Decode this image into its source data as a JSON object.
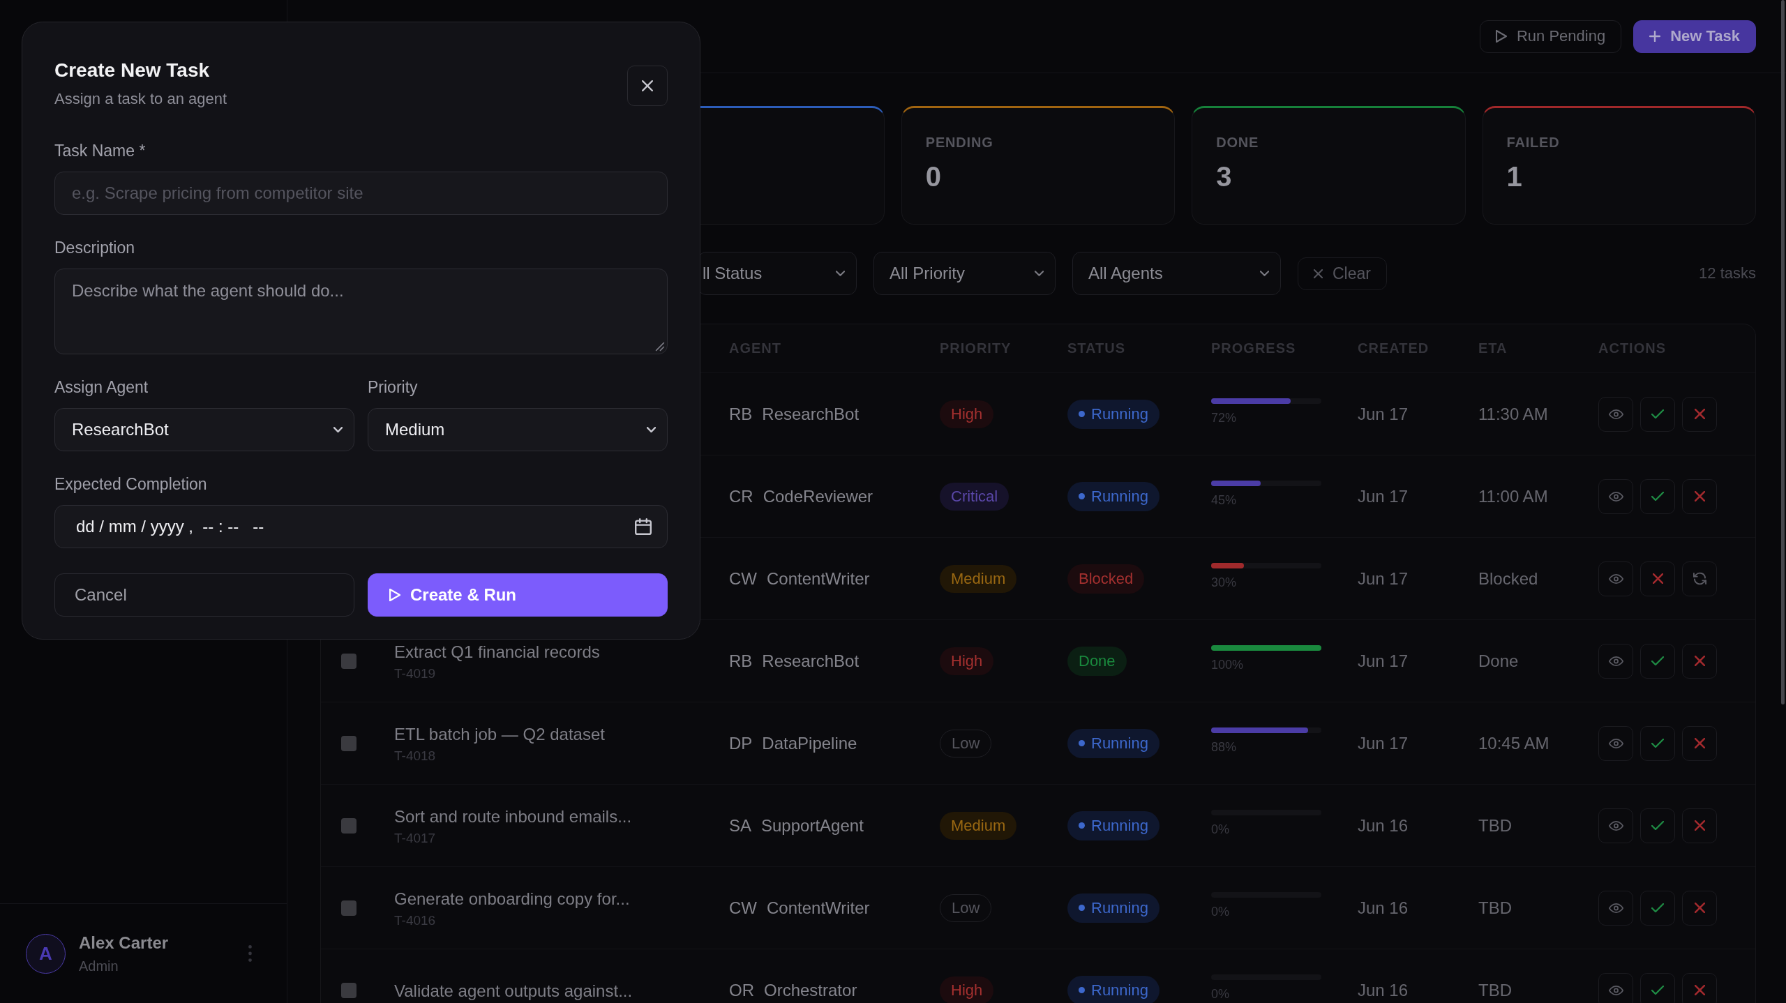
{
  "sidebar": {
    "user": {
      "initial": "A",
      "name": "Alex Carter",
      "role": "Admin"
    }
  },
  "header": {
    "run_pending_button": "Run Pending",
    "new_task_button": "New Task"
  },
  "stats": [
    {
      "color": "#2c5cb8"
    },
    {
      "label": "PENDING",
      "value": "0",
      "color": "#a06410"
    },
    {
      "label": "DONE",
      "value": "3",
      "color": "#16803a"
    },
    {
      "label": "FAILED",
      "value": "1",
      "color": "#a0282a"
    }
  ],
  "filters": {
    "selects": [
      "ll Status",
      "All Priority",
      "All Agents"
    ],
    "clear_button": "Clear",
    "count": "12 tasks"
  },
  "table": {
    "columns": [
      "AGENT",
      "PRIORITY",
      "STATUS",
      "PROGRESS",
      "CREATED",
      "ETA",
      "ACTIONS"
    ],
    "rows": [
      {
        "agent_initials": "RB",
        "agent": "ResearchBot",
        "priority": {
          "label": "High",
          "kind": "high"
        },
        "status": {
          "label": "Running",
          "kind": "running"
        },
        "progress": {
          "level": 0.72,
          "label": "72%"
        },
        "created": "Jun 17",
        "eta": "11:30 AM",
        "actions": [
          {
            "kind": "view"
          },
          {
            "kind": "approve"
          },
          {
            "kind": "cancel"
          }
        ]
      },
      {
        "agent_initials": "CR",
        "agent": "CodeReviewer",
        "priority": {
          "label": "Critical",
          "kind": "critical"
        },
        "status": {
          "label": "Running",
          "kind": "running"
        },
        "progress": {
          "level": 0.45,
          "label": "45%"
        },
        "created": "Jun 17",
        "eta": "11:00 AM",
        "actions": [
          {
            "kind": "view"
          },
          {
            "kind": "approve"
          },
          {
            "kind": "cancel"
          }
        ]
      },
      {
        "agent_initials": "CW",
        "agent": "ContentWriter",
        "priority": {
          "label": "Medium",
          "kind": "medium"
        },
        "status": {
          "label": "Blocked",
          "kind": "blocked"
        },
        "progress": {
          "level": 0.3,
          "label": "30%"
        },
        "created": "Jun 17",
        "eta": "Blocked",
        "actions": [
          {
            "kind": "view"
          },
          {
            "kind": "cancel"
          },
          {
            "kind": "retry"
          }
        ]
      },
      {
        "checked": false,
        "name": "Extract Q1 financial records",
        "id": "T-4019",
        "agent_initials": "RB",
        "agent": "ResearchBot",
        "priority": {
          "label": "High",
          "kind": "high"
        },
        "status": {
          "label": "Done",
          "kind": "done"
        },
        "progress": {
          "level": 1,
          "label": "100%"
        },
        "created": "Jun 17",
        "eta": "Done",
        "actions": [
          {
            "kind": "view"
          },
          {
            "kind": "approve"
          },
          {
            "kind": "cancel"
          }
        ]
      },
      {
        "checked": false,
        "name": "ETL batch job — Q2 dataset",
        "id": "T-4018",
        "agent_initials": "DP",
        "agent": "DataPipeline",
        "priority": {
          "label": "Low",
          "kind": "low"
        },
        "status": {
          "label": "Running",
          "kind": "running"
        },
        "progress": {
          "level": 0.88,
          "label": "88%"
        },
        "created": "Jun 17",
        "eta": "10:45 AM",
        "actions": [
          {
            "kind": "view"
          },
          {
            "kind": "approve"
          },
          {
            "kind": "cancel"
          }
        ]
      },
      {
        "checked": false,
        "name": "Sort and route inbound emails...",
        "id": "T-4017",
        "agent_initials": "SA",
        "agent": "SupportAgent",
        "priority": {
          "label": "Medium",
          "kind": "medium"
        },
        "status": {
          "label": "Running",
          "kind": "running"
        },
        "progress": {
          "level": 0,
          "label": "0%"
        },
        "created": "Jun 16",
        "eta": "TBD",
        "actions": [
          {
            "kind": "view"
          },
          {
            "kind": "approve"
          },
          {
            "kind": "cancel"
          }
        ]
      },
      {
        "checked": false,
        "name": "Generate onboarding copy for...",
        "id": "T-4016",
        "agent_initials": "CW",
        "agent": "ContentWriter",
        "priority": {
          "label": "Low",
          "kind": "low"
        },
        "status": {
          "label": "Running",
          "kind": "running"
        },
        "progress": {
          "level": 0,
          "label": "0%"
        },
        "created": "Jun 16",
        "eta": "TBD",
        "actions": [
          {
            "kind": "view"
          },
          {
            "kind": "approve"
          },
          {
            "kind": "cancel"
          }
        ]
      },
      {
        "checked": false,
        "name": "Validate agent outputs against...",
        "agent_initials": "OR",
        "agent": "Orchestrator",
        "priority": {
          "label": "High",
          "kind": "high"
        },
        "status": {
          "label": "Running",
          "kind": "running"
        },
        "progress": {
          "level": 0,
          "label": "0%"
        },
        "created": "Jun 16",
        "eta": "TBD",
        "actions": [
          {
            "kind": "view"
          },
          {
            "kind": "approve"
          },
          {
            "kind": "cancel"
          }
        ]
      }
    ]
  },
  "modal": {
    "title": "Create New Task",
    "subtitle": "Assign a task to an agent",
    "task_name": {
      "label": "Task Name *",
      "placeholder": "e.g. Scrape pricing from competitor site"
    },
    "description": {
      "label": "Description",
      "placeholder": "Describe what the agent should do..."
    },
    "agent": {
      "label": "Assign Agent",
      "value": "ResearchBot"
    },
    "priority": {
      "label": "Priority",
      "value": "Medium"
    },
    "expected_completion": {
      "label": "Expected Completion",
      "placeholder": "dd / mm / yyyy ,  -- : --   --"
    },
    "cancel_button": "Cancel",
    "submit_button": "Create & Run"
  }
}
